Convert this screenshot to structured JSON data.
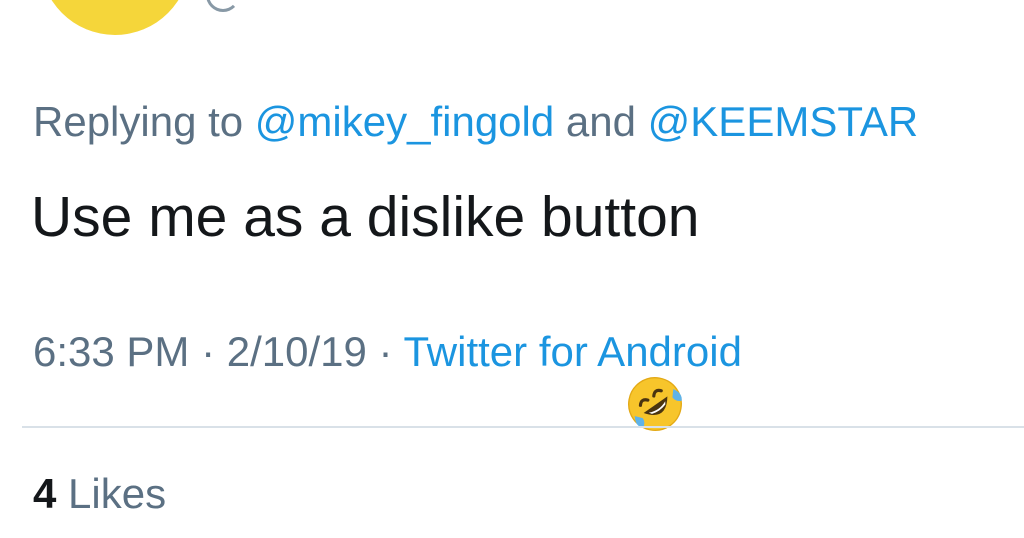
{
  "reply": {
    "prefix": "Replying to ",
    "mention1": "@mikey_fingold",
    "conjunction": " and ",
    "mention2": "@KEEMSTAR"
  },
  "tweet": {
    "text": "Use me as a dislike button"
  },
  "meta": {
    "time": "6:33 PM",
    "sep1": " · ",
    "date": "2/10/19",
    "sep2": " · ",
    "source": "Twitter for Android"
  },
  "emoji": {
    "name": "rolling-on-the-floor-laughing-emoji"
  },
  "stats": {
    "likes_count": "4",
    "likes_label": " Likes"
  },
  "colors": {
    "link": "#1b95e0",
    "secondary_text": "#5b7083",
    "primary_text": "#14171a",
    "divider": "#d9e1e8",
    "avatar": "#f5d63a"
  }
}
